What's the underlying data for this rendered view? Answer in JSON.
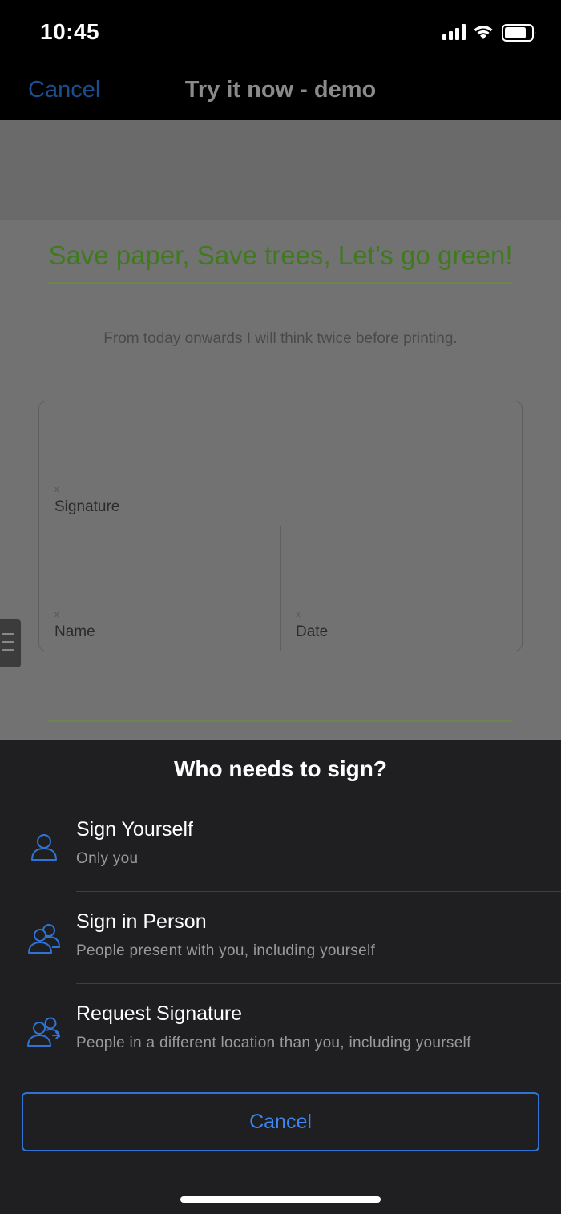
{
  "status_bar": {
    "time": "10:45",
    "icons": [
      "signal-icon",
      "wifi-icon",
      "battery-icon"
    ]
  },
  "nav": {
    "cancel_label": "Cancel",
    "title": "Try it now - demo"
  },
  "document": {
    "heading": "Save paper, Save trees, Let’s go green!",
    "body": "From today onwards I will think twice before printing.",
    "fields": {
      "signature": {
        "marker": "x",
        "label": "Signature"
      },
      "name": {
        "marker": "x",
        "label": "Name"
      },
      "date": {
        "marker": "x",
        "label": "Date"
      }
    }
  },
  "sheet": {
    "title": "Who needs to sign?",
    "options": [
      {
        "icon": "person-icon",
        "title": "Sign Yourself",
        "subtitle": "Only you"
      },
      {
        "icon": "people-icon",
        "title": "Sign in Person",
        "subtitle": "People present with you, including yourself"
      },
      {
        "icon": "people-request-icon",
        "title": "Request Signature",
        "subtitle": "People in a different location than you, including yourself"
      }
    ],
    "cancel_label": "Cancel"
  },
  "colors": {
    "accent_blue": "#3b86f0",
    "heading_green": "#3f7a1f",
    "sheet_background": "#1f1f21"
  }
}
